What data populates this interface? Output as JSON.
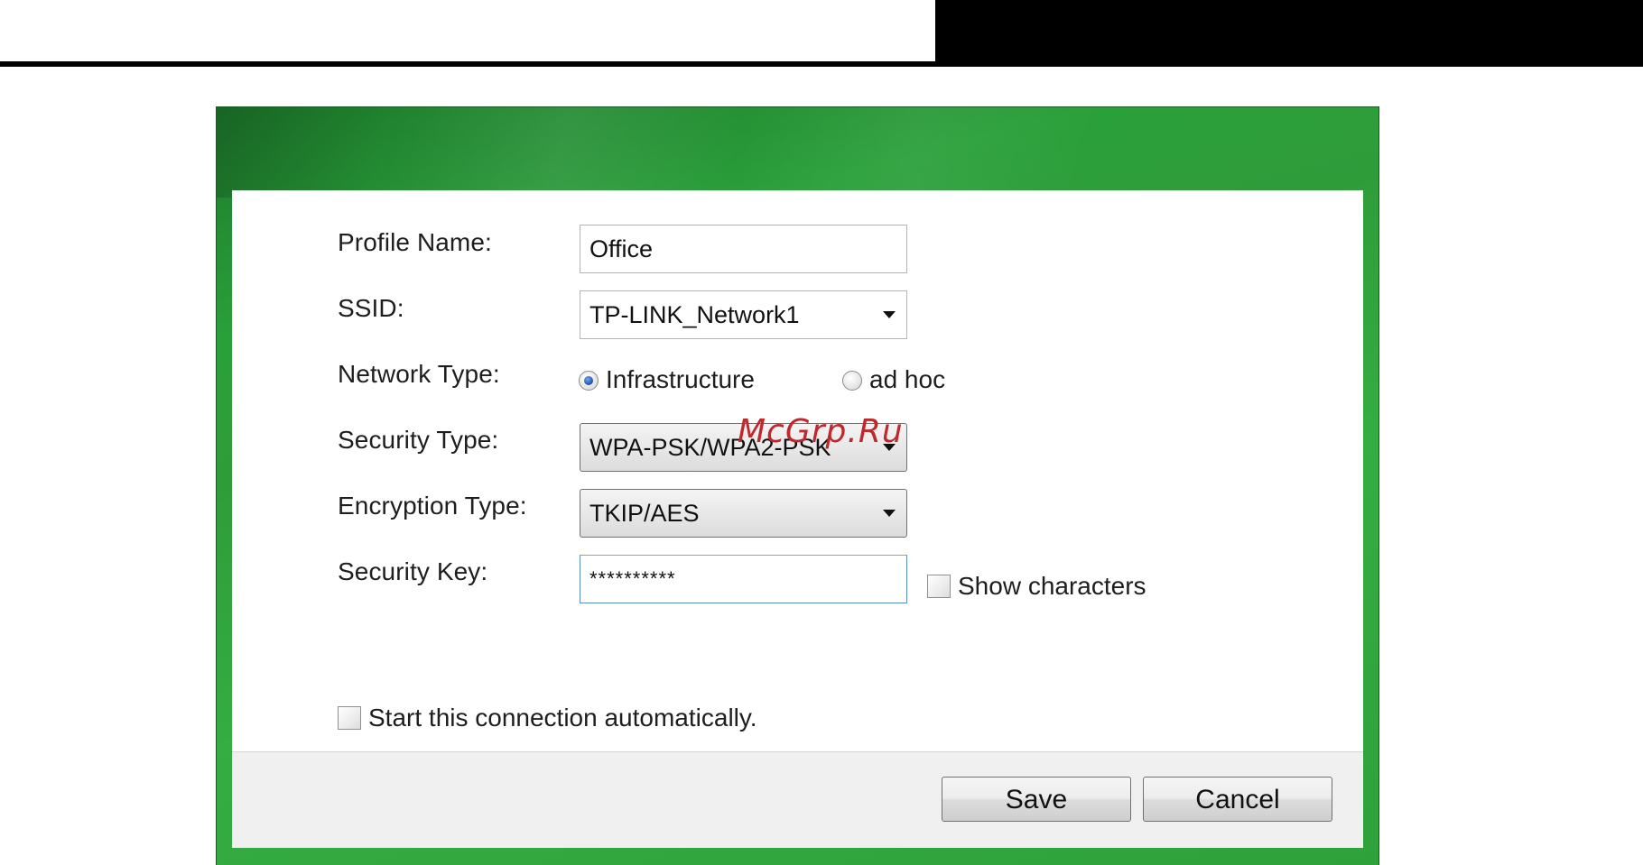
{
  "form": {
    "profile_name_label": "Profile Name:",
    "profile_name_value": "Office",
    "ssid_label": "SSID:",
    "ssid_value": "TP-LINK_Network1",
    "network_type_label": "Network Type:",
    "network_type_options": [
      "Infrastructure",
      "ad hoc"
    ],
    "network_type_selected": "Infrastructure",
    "security_type_label": "Security Type:",
    "security_type_value": "WPA-PSK/WPA2-PSK",
    "encryption_type_label": "Encryption Type:",
    "encryption_type_value": "TKIP/AES",
    "security_key_label": "Security Key:",
    "security_key_value": "**********",
    "show_characters_label": "Show characters",
    "auto_connect_label": "Start this connection automatically."
  },
  "buttons": {
    "save_label": "Save",
    "cancel_label": "Cancel"
  },
  "watermark": {
    "text": "McGrp.Ru"
  },
  "colors": {
    "frame_green": "#2fa13b",
    "watermark_red": "#c0282d",
    "radio_selected_blue": "#1d4f9e"
  }
}
